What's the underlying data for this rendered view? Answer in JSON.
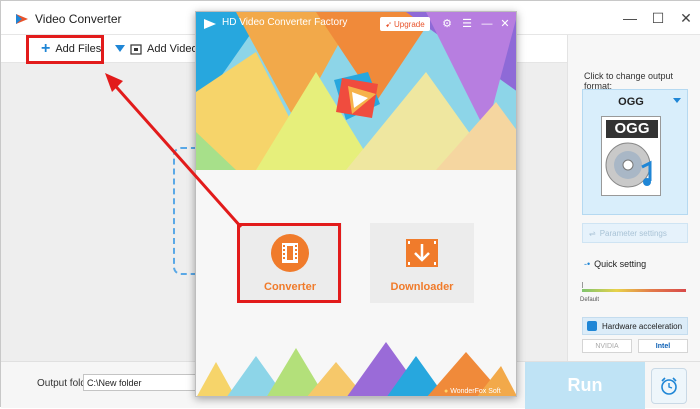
{
  "window": {
    "title": "Video Converter",
    "controls": [
      "—",
      "☐",
      "✕"
    ]
  },
  "toolbar": {
    "add_files": "Add Files",
    "add_video_folder": "Add Video Fol"
  },
  "bottom": {
    "output_folder_label": "Output folder:",
    "output_folder_value": "C:\\New folder",
    "run_label": "Run"
  },
  "right_panel": {
    "heading": "Click to change output format:",
    "format_name": "OGG",
    "format_card_text": "OGG",
    "parameter_settings": "Parameter settings",
    "quick_setting": "Quick setting",
    "default_label": "Default",
    "hardware_acceleration": "Hardware acceleration",
    "gpu_nvidia": "NVIDIA",
    "gpu_intel": "Intel"
  },
  "popup": {
    "title": "HD Video Converter Factory",
    "upgrade_label": "Upgrade",
    "converter_label": "Converter",
    "downloader_label": "Downloader",
    "footer_brand": "WonderFox Soft"
  },
  "colors": {
    "accent": "#1f86d6",
    "highlight": "#e21b1b",
    "tile_text": "#f07b2b",
    "run_button": "#bfe3f5"
  }
}
